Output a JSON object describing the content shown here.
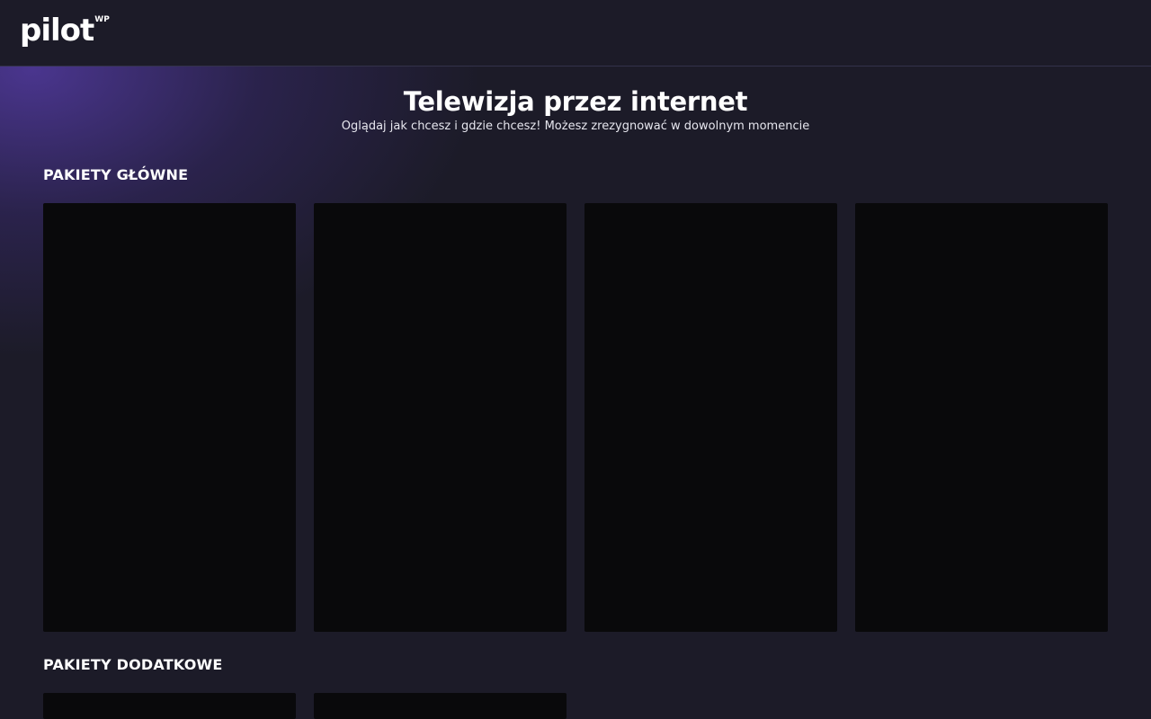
{
  "header": {
    "logo_text": "pilot",
    "logo_sup": "WP"
  },
  "hero": {
    "title": "Telewizja przez internet",
    "subtitle": "Oglądaj jak chcesz i gdzie chcesz! Możesz zrezygnować w dowolnym momencie"
  },
  "sections": {
    "main": {
      "title": "PAKIETY GŁÓWNE",
      "card_count": 4
    },
    "extra": {
      "title": "PAKIETY DODATKOWE",
      "card_count": 2
    }
  },
  "colors": {
    "background": "#1c1b28",
    "card": "#09090b",
    "accent_glow": "#523aa0"
  }
}
